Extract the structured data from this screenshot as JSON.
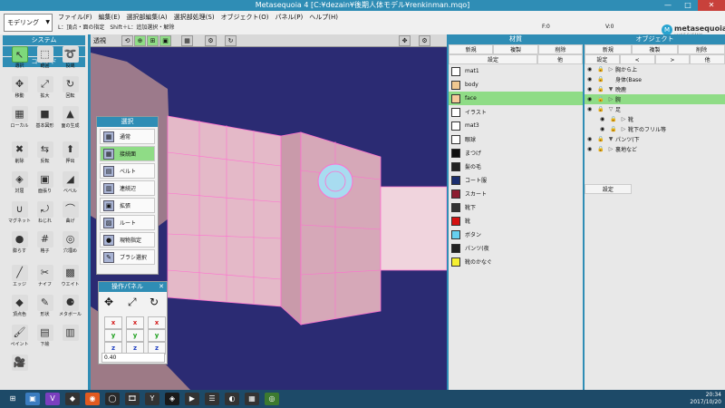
{
  "window": {
    "title": "Metasequoia 4 [C:¥dezain¥後期人体モデル¥renkinman.mqo]",
    "minimize": "—",
    "maximize": "□",
    "close": "✕"
  },
  "menubar": {
    "mode": "モデリング",
    "items": [
      "ファイル(F)",
      "編集(E)",
      "選択部編集(A)",
      "選択部処理(S)",
      "オブジェクト(O)",
      "パネル(P)",
      "ヘルプ(H)"
    ],
    "status": "L：頂点・面の指定　Shift＋L：追加選択・解除",
    "face_count": "F:0",
    "vertex_count": "V:0"
  },
  "logo": {
    "text": "metasequoia4",
    "version": "ver4.5.9 (64bit)"
  },
  "left_panel": {
    "system_label": "システム",
    "edit_label": "編集",
    "command_label": "コマンド",
    "tools": [
      {
        "label": "選択",
        "icon": "↖"
      },
      {
        "label": "範囲",
        "icon": "⬚"
      },
      {
        "label": "投縄",
        "icon": "➰"
      },
      {
        "label": "移動",
        "icon": "✥"
      },
      {
        "label": "拡大",
        "icon": "⤢"
      },
      {
        "label": "回転",
        "icon": "↻"
      },
      {
        "label": "ローカル",
        "icon": "▦"
      },
      {
        "label": "基本図形",
        "icon": "■"
      },
      {
        "label": "面の生成",
        "icon": "▲"
      },
      {
        "label": "削除",
        "icon": "✖"
      },
      {
        "label": "反転",
        "icon": "⇆"
      },
      {
        "label": "押出",
        "icon": "⬆"
      },
      {
        "label": "対屈",
        "icon": "◈"
      },
      {
        "label": "面張り",
        "icon": "▣"
      },
      {
        "label": "ベベル",
        "icon": "◢"
      },
      {
        "label": "マグネット",
        "icon": "∪"
      },
      {
        "label": "ねじれ",
        "icon": "⤾"
      },
      {
        "label": "曲げ",
        "icon": "⌒"
      },
      {
        "label": "膨らす",
        "icon": "●"
      },
      {
        "label": "格子",
        "icon": "#"
      },
      {
        "label": "穴埋め",
        "icon": "◎"
      },
      {
        "label": "エッジ",
        "icon": "╱"
      },
      {
        "label": "ナイフ",
        "icon": "✂"
      },
      {
        "label": "ウエイト",
        "icon": "▩"
      },
      {
        "label": "頂点色",
        "icon": "◆"
      },
      {
        "label": "形状",
        "icon": "✎"
      },
      {
        "label": "メタボール",
        "icon": "⚈"
      },
      {
        "label": "ペイント",
        "icon": "🖌"
      },
      {
        "label": "下絵",
        "icon": "▤"
      },
      {
        "label": "",
        "icon": "▥"
      },
      {
        "label": "",
        "icon": "🎥"
      }
    ]
  },
  "viewport_toolbar": {
    "persp_label": "透視",
    "icons": [
      "⟲",
      "⊕",
      "⊞",
      "▣",
      "▦",
      "⚙",
      "↻",
      "✥",
      "⚙"
    ]
  },
  "selection_popup": {
    "title": "選択",
    "options": [
      {
        "label": "通常",
        "icon": "▦"
      },
      {
        "label": "接続面",
        "icon": "▦"
      },
      {
        "label": "ベルト",
        "icon": "▤"
      },
      {
        "label": "連続辺",
        "icon": "▥"
      },
      {
        "label": "拡張",
        "icon": "▣"
      },
      {
        "label": "ルート",
        "icon": "▨"
      },
      {
        "label": "現物指定",
        "icon": "●"
      },
      {
        "label": "ブラシ選択",
        "icon": "✎"
      }
    ]
  },
  "op_panel": {
    "title": "操作パネル",
    "value": "0.40",
    "axes": [
      "x",
      "y",
      "z"
    ]
  },
  "materials": {
    "title": "材質",
    "buttons": [
      "新規",
      "複製",
      "削除"
    ],
    "settings_label": "設定",
    "extra_label": "他",
    "items": [
      {
        "name": "mat1",
        "color": "#ffffff"
      },
      {
        "name": "body",
        "color": "#f0c890"
      },
      {
        "name": "face",
        "color": "#f4c99a"
      },
      {
        "name": "イラスト",
        "color": "#ffffff"
      },
      {
        "name": "mat3",
        "color": "#ffffff"
      },
      {
        "name": "眼球",
        "color": "#ffffff"
      },
      {
        "name": "まつげ",
        "color": "#111111"
      },
      {
        "name": "髪の毛",
        "color": "#222222"
      },
      {
        "name": "コート服",
        "color": "#1b2e6e"
      },
      {
        "name": "スカート",
        "color": "#8c1d30"
      },
      {
        "name": "靴下",
        "color": "#333333"
      },
      {
        "name": "靴",
        "color": "#d41010"
      },
      {
        "name": "ボタン",
        "color": "#66d0f0"
      },
      {
        "name": "パンツ(夜",
        "color": "#222222"
      },
      {
        "name": "靴のかなぐ",
        "color": "#f5ef30"
      }
    ]
  },
  "objects": {
    "title": "オブジェクト",
    "buttons": [
      "新規",
      "複製",
      "削除"
    ],
    "nav_buttons": [
      "設定",
      "<",
      ">",
      "他"
    ],
    "settings_label": "設定",
    "items": [
      {
        "name": "胸から上",
        "indent": 0,
        "expand": "▷"
      },
      {
        "name": "身体(Base",
        "indent": 0,
        "expand": ""
      },
      {
        "name": "晩鹿",
        "indent": 0,
        "expand": "▼"
      },
      {
        "name": "腕",
        "indent": 0,
        "expand": "▷"
      },
      {
        "name": "足",
        "indent": 0,
        "expand": "▽"
      },
      {
        "name": "靴",
        "indent": 1,
        "expand": "▷"
      },
      {
        "name": "靴下のフリル等",
        "indent": 1,
        "expand": "▷"
      },
      {
        "name": "パンツ(下",
        "indent": 0,
        "expand": "▼"
      },
      {
        "name": "裏地など",
        "indent": 0,
        "expand": "▷"
      }
    ]
  },
  "taskbar": {
    "icons": [
      "⊞",
      "▣",
      "V",
      "◆",
      "◉",
      "◯",
      "🎞",
      "Y",
      "◈",
      "▶",
      "☰",
      "◐",
      "▦",
      "◎"
    ],
    "time": "20:34",
    "date": "2017/10/20"
  },
  "colors": {
    "accent": "#2f8db5",
    "selected": "#8fdc86",
    "viewport": "#2b2b73",
    "mesh": "#e4b9c8"
  }
}
